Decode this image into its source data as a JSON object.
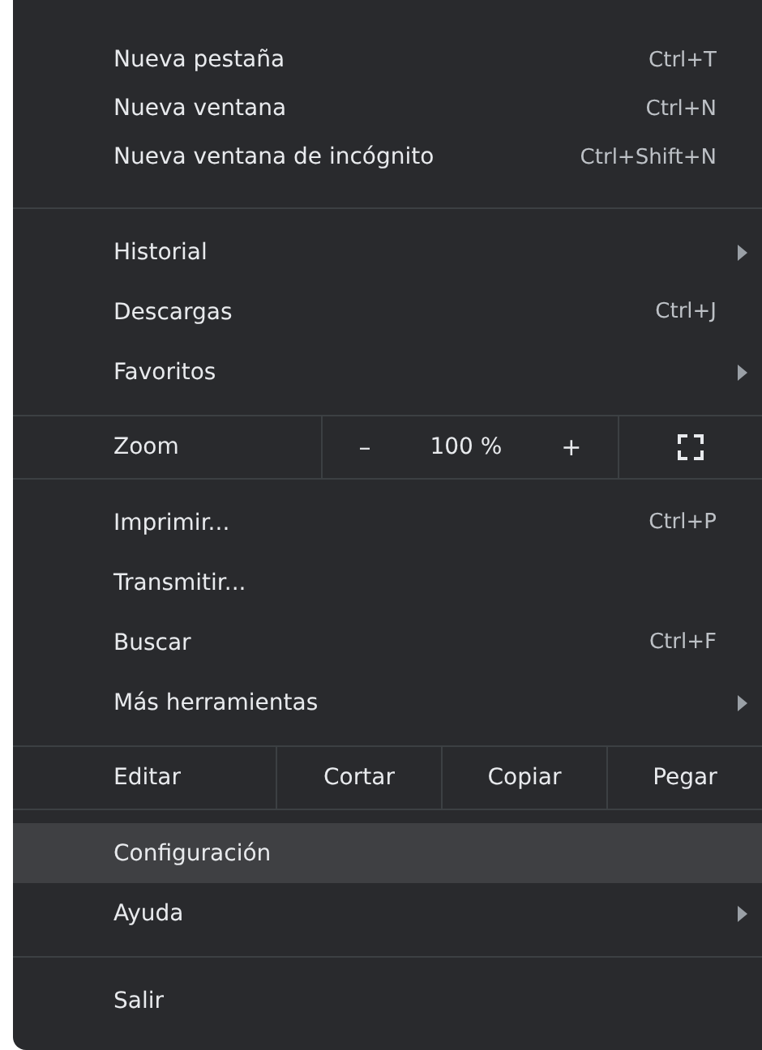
{
  "menu": {
    "sections": [
      {
        "kind": "items",
        "items": [
          {
            "label": "Nueva pestaña",
            "shortcut": "Ctrl+T",
            "submenu": false,
            "selected": false
          },
          {
            "label": "Nueva ventana",
            "shortcut": "Ctrl+N",
            "submenu": false,
            "selected": false
          },
          {
            "label": "Nueva ventana de incógnito",
            "shortcut": "Ctrl+Shift+N",
            "submenu": false,
            "selected": false
          }
        ]
      },
      {
        "kind": "items",
        "items": [
          {
            "label": "Historial",
            "submenu": true,
            "selected": false
          },
          {
            "label": "Descargas",
            "shortcut": "Ctrl+J",
            "submenu": false,
            "selected": false
          },
          {
            "label": "Favoritos",
            "submenu": true,
            "selected": false
          }
        ]
      },
      {
        "kind": "zoom",
        "label": "Zoom",
        "decrease": "–",
        "value": "100 %",
        "increase": "+"
      },
      {
        "kind": "items",
        "items": [
          {
            "label": "Imprimir...",
            "shortcut": "Ctrl+P",
            "submenu": false,
            "selected": false
          },
          {
            "label": "Transmitir...",
            "submenu": false,
            "selected": false
          },
          {
            "label": "Buscar",
            "shortcut": "Ctrl+F",
            "submenu": false,
            "selected": false
          },
          {
            "label": "Más herramientas",
            "submenu": true,
            "selected": false
          }
        ]
      },
      {
        "kind": "edit",
        "label": "Editar",
        "buttons": [
          "Cortar",
          "Copiar",
          "Pegar"
        ]
      },
      {
        "kind": "items",
        "items": [
          {
            "label": "Configuración",
            "submenu": false,
            "selected": true
          },
          {
            "label": "Ayuda",
            "submenu": true,
            "selected": false
          }
        ]
      },
      {
        "kind": "items",
        "items": [
          {
            "label": "Salir",
            "submenu": false,
            "selected": false
          }
        ]
      }
    ]
  }
}
